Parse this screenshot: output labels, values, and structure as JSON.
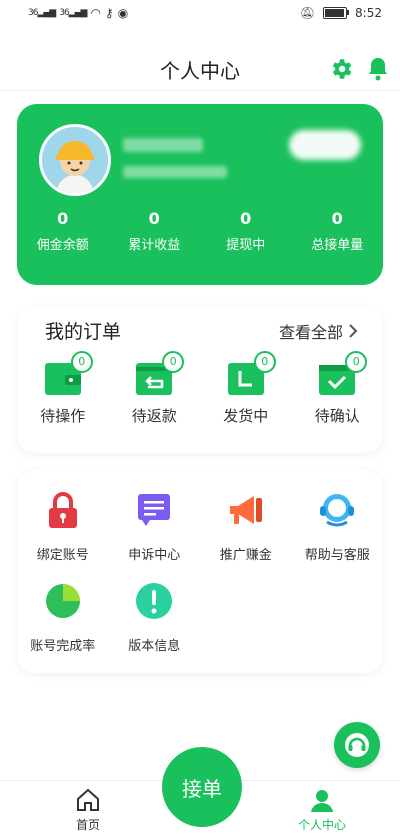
{
  "status_bar": {
    "signal1": "36",
    "signal2": "36",
    "time": "8:52"
  },
  "header": {
    "title": "个人中心"
  },
  "profile": {
    "stats": [
      {
        "value": "0",
        "label": "佣金余额"
      },
      {
        "value": "0",
        "label": "累计收益"
      },
      {
        "value": "0",
        "label": "提现中"
      },
      {
        "value": "0",
        "label": "总接单量"
      }
    ]
  },
  "orders": {
    "title": "我的订单",
    "view_all": "查看全部",
    "items": [
      {
        "label": "待操作",
        "count": "0"
      },
      {
        "label": "待返款",
        "count": "0"
      },
      {
        "label": "发货中",
        "count": "0"
      },
      {
        "label": "待确认",
        "count": "0"
      }
    ]
  },
  "tools": [
    {
      "label": "绑定账号",
      "icon": "lock-icon"
    },
    {
      "label": "申诉中心",
      "icon": "appeal-icon"
    },
    {
      "label": "推广赚金",
      "icon": "megaphone-icon"
    },
    {
      "label": "帮助与客服",
      "icon": "support-icon"
    },
    {
      "label": "账号完成率",
      "icon": "pie-chart-icon"
    },
    {
      "label": "版本信息",
      "icon": "info-icon"
    }
  ],
  "tabbar": {
    "home": "首页",
    "center": "接单",
    "me": "个人中心"
  },
  "colors": {
    "primary": "#19c05b"
  }
}
